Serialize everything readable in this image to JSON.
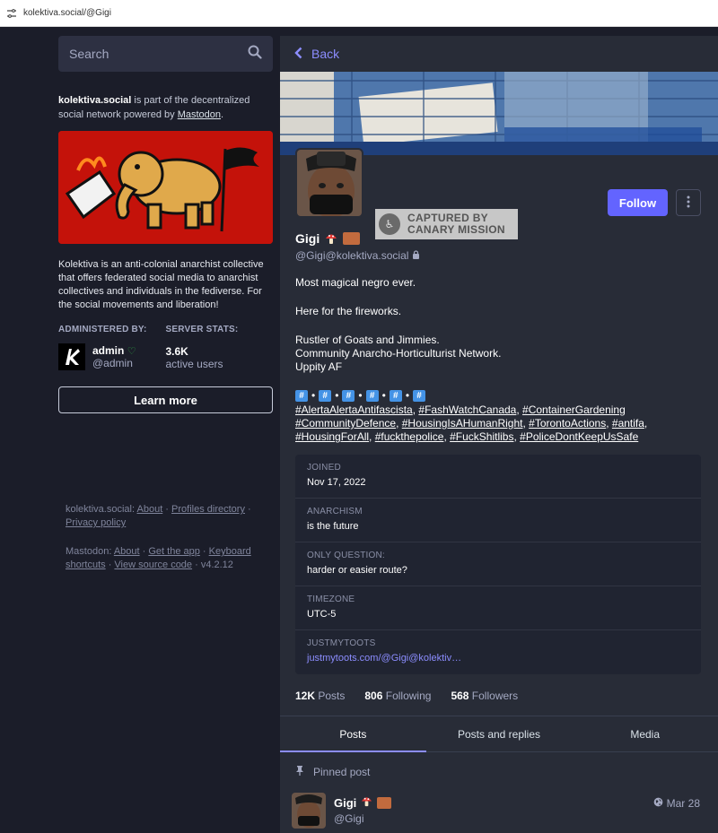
{
  "browser": {
    "url": "kolektiva.social/@Gigi"
  },
  "search": {
    "placeholder": "Search"
  },
  "server": {
    "intro_name": "kolektiva.social",
    "intro_text": " is part of the decentralized social network powered by ",
    "intro_link": "Mastodon",
    "intro_end": ".",
    "about": "Kolektiva is an anti-colonial anarchist collective that offers federated social media to anarchist collectives and individuals in the fediverse. For the social movements and liberation!",
    "admin_heading": "ADMINISTERED BY:",
    "stats_heading": "SERVER STATS:",
    "admin_name": "admin",
    "admin_handle": "@admin",
    "active_users": "3.6K",
    "active_label": "active users",
    "learn_more": "Learn more"
  },
  "footer": {
    "site": "kolektiva.social",
    "about": "About",
    "profiles": "Profiles directory",
    "privacy": "Privacy policy",
    "mastodon": "Mastodon",
    "about2": "About",
    "get_app": "Get the app",
    "shortcuts": "Keyboard shortcuts",
    "source": "View source code",
    "version": "v4.2.12"
  },
  "profile": {
    "back": "Back",
    "follow": "Follow",
    "display_name": "Gigi",
    "handle": "@Gigi@kolektiva.social",
    "watermark_line1": "CAPTURED BY",
    "watermark_line2": "CANARY MISSION",
    "bio": [
      "Most magical negro ever.",
      "Here for the fireworks.",
      "Rustler of Goats and Jimmies.",
      "Community Anarcho-Horticulturist Network.",
      "Uppity AF"
    ],
    "hash_glyph": "#",
    "hash_sep": "•",
    "tags": [
      "#AlertaAlertaAntifascista",
      "#FashWatchCanada",
      "#ContainerGardening",
      "#CommunityDefence",
      "#HousingIsAHumanRight",
      "#TorontoActions",
      "#antifa",
      "#HousingForAll",
      "#fuckthepolice",
      "#FuckShitlibs",
      "#PoliceDontKeepUsSafe"
    ],
    "fields": [
      {
        "label": "JOINED",
        "value": "Nov 17, 2022"
      },
      {
        "label": "ANARCHISM",
        "value": "is the future"
      },
      {
        "label": "ONLY QUESTION:",
        "value": "harder or easier route?"
      },
      {
        "label": "TIMEZONE",
        "value": "UTC-5"
      },
      {
        "label": "JUSTMYTOOTS",
        "value": "justmytoots.com/@Gigi@kolektiv…"
      }
    ],
    "counts": {
      "posts_num": "12K",
      "posts_label": " Posts",
      "following_num": "806",
      "following_label": " Following",
      "followers_num": "568",
      "followers_label": " Followers"
    },
    "tabs": [
      "Posts",
      "Posts and replies",
      "Media"
    ],
    "pinned_label": "Pinned post",
    "post": {
      "name": "Gigi",
      "handle": "@Gigi",
      "time": "Mar 28"
    }
  },
  "colors": {
    "accent": "#6364ff",
    "link": "#8c8dff",
    "bg": "#1b1d29",
    "panel": "#282c37",
    "hero_red": "#c4120a"
  }
}
